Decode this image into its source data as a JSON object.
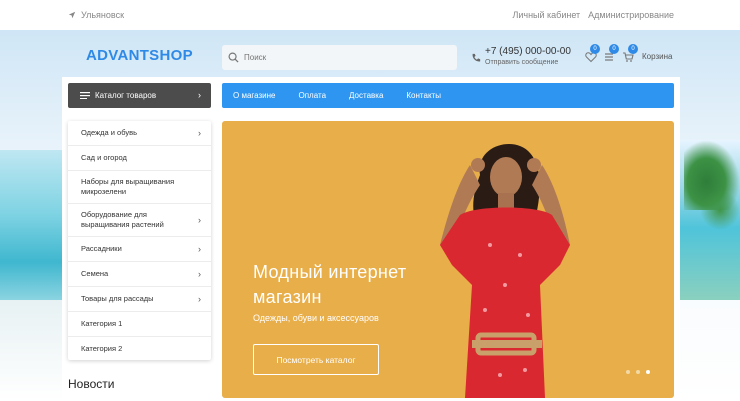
{
  "topbar": {
    "city": "Ульяновск",
    "links": [
      "Личный кабинет",
      "Администрирование"
    ]
  },
  "header": {
    "logo": "ADVANTSHOP",
    "search_placeholder": "Поиск",
    "phone": "+7 (495) 000-00-00",
    "send_message": "Отправить сообщение",
    "wishlist_count": "0",
    "compare_count": "0",
    "cart_count": "0",
    "cart_label": "Корзина"
  },
  "catalog": {
    "button_label": "Каталог товаров",
    "items": [
      {
        "label": "Одежда и обувь",
        "has_arrow": true
      },
      {
        "label": "Сад и огород",
        "has_arrow": false
      },
      {
        "label": "Наборы для выращивания микрозелени",
        "has_arrow": false
      },
      {
        "label": "Оборудование для выращивания растений",
        "has_arrow": true
      },
      {
        "label": "Рассадники",
        "has_arrow": true
      },
      {
        "label": "Семена",
        "has_arrow": true
      },
      {
        "label": "Товары для рассады",
        "has_arrow": true
      },
      {
        "label": "Категория 1",
        "has_arrow": false
      },
      {
        "label": "Категория 2",
        "has_arrow": false
      }
    ]
  },
  "nav": [
    "О магазине",
    "Оплата",
    "Доставка",
    "Контакты"
  ],
  "hero": {
    "title": "Модный интернет магазин",
    "subtitle": "Одежды, обуви и аксессуаров",
    "button": "Посмотреть каталог",
    "slides": 3,
    "active_slide": 3
  },
  "news_title": "Новости",
  "colors": {
    "accent": "#2e96f0",
    "logo": "#2e8ae6",
    "hero_bg": "#e8ae4a",
    "catalog_btn": "#4c4c4c"
  }
}
